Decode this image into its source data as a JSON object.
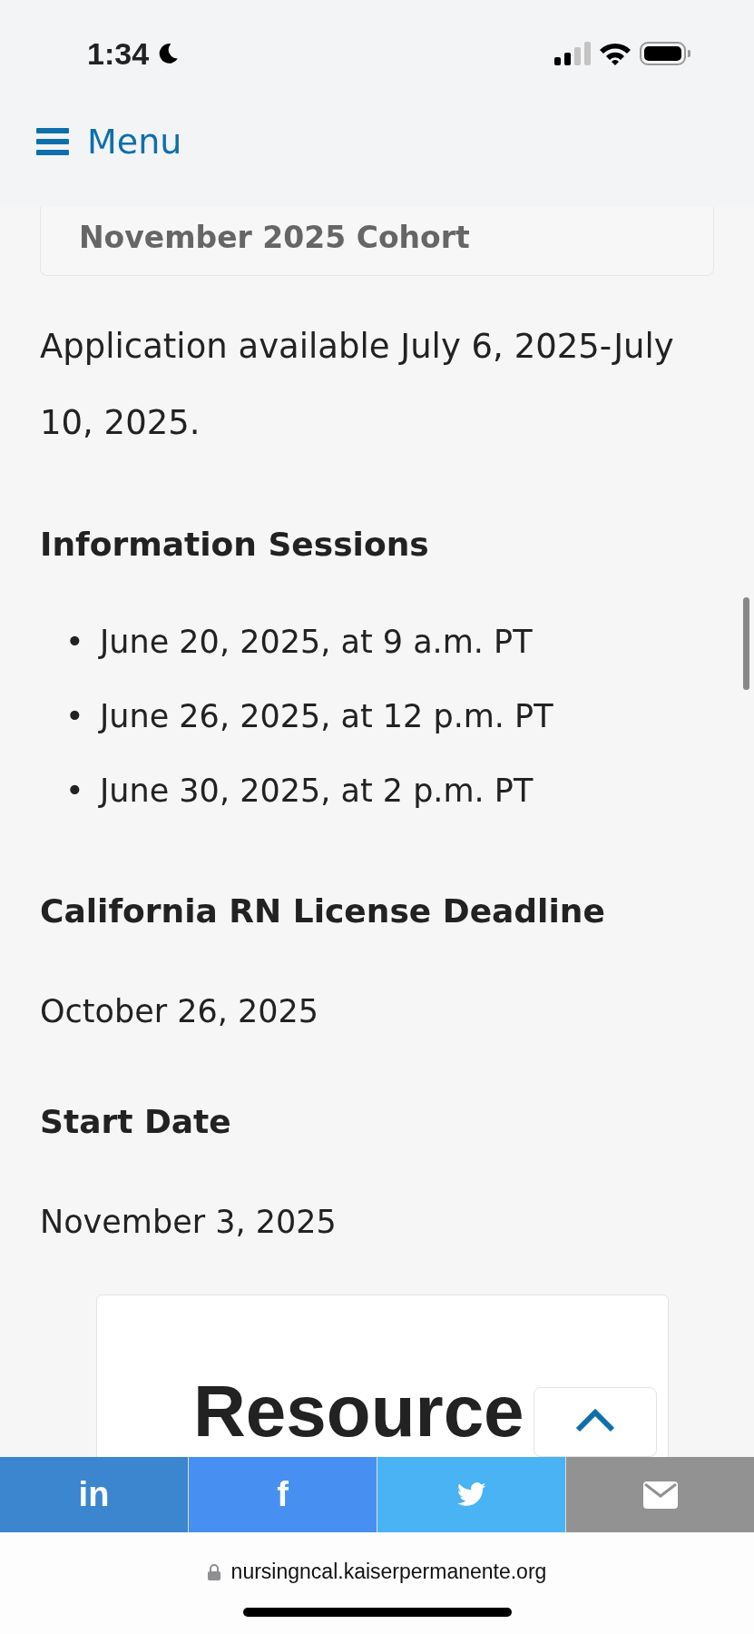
{
  "status_bar": {
    "time": "1:34"
  },
  "header": {
    "menu_label": "Menu"
  },
  "cohort_card": {
    "title": "November 2025 Cohort"
  },
  "application": "Application available July 6, 2025-July 10, 2025.",
  "sections": [
    {
      "heading": "Information Sessions",
      "items": [
        {
          "marker": "•",
          "text": "June 20, 2025, at 9 a.m. PT"
        },
        {
          "marker": "•",
          "text": "June 26, 2025, at 12 p.m. PT"
        },
        {
          "marker": "•",
          "text": "June 30, 2025, at 2 p.m. PT"
        }
      ]
    },
    {
      "heading": "California RN License Deadline",
      "text": "October 26, 2025"
    },
    {
      "heading": "Start Date",
      "text": "November 3, 2025"
    }
  ],
  "resources_card": {
    "title": "Resource"
  },
  "share_bar": [
    {
      "kind": "linkedin",
      "label": "in",
      "color": "#3b86cf"
    },
    {
      "kind": "facebook",
      "label": "f",
      "color": "#4790f2"
    },
    {
      "kind": "twitter",
      "color": "#4ab3f4"
    },
    {
      "kind": "email",
      "color": "#929292"
    }
  ],
  "url_bar": {
    "url": "nursingncal.kaiserpermanente.org"
  }
}
